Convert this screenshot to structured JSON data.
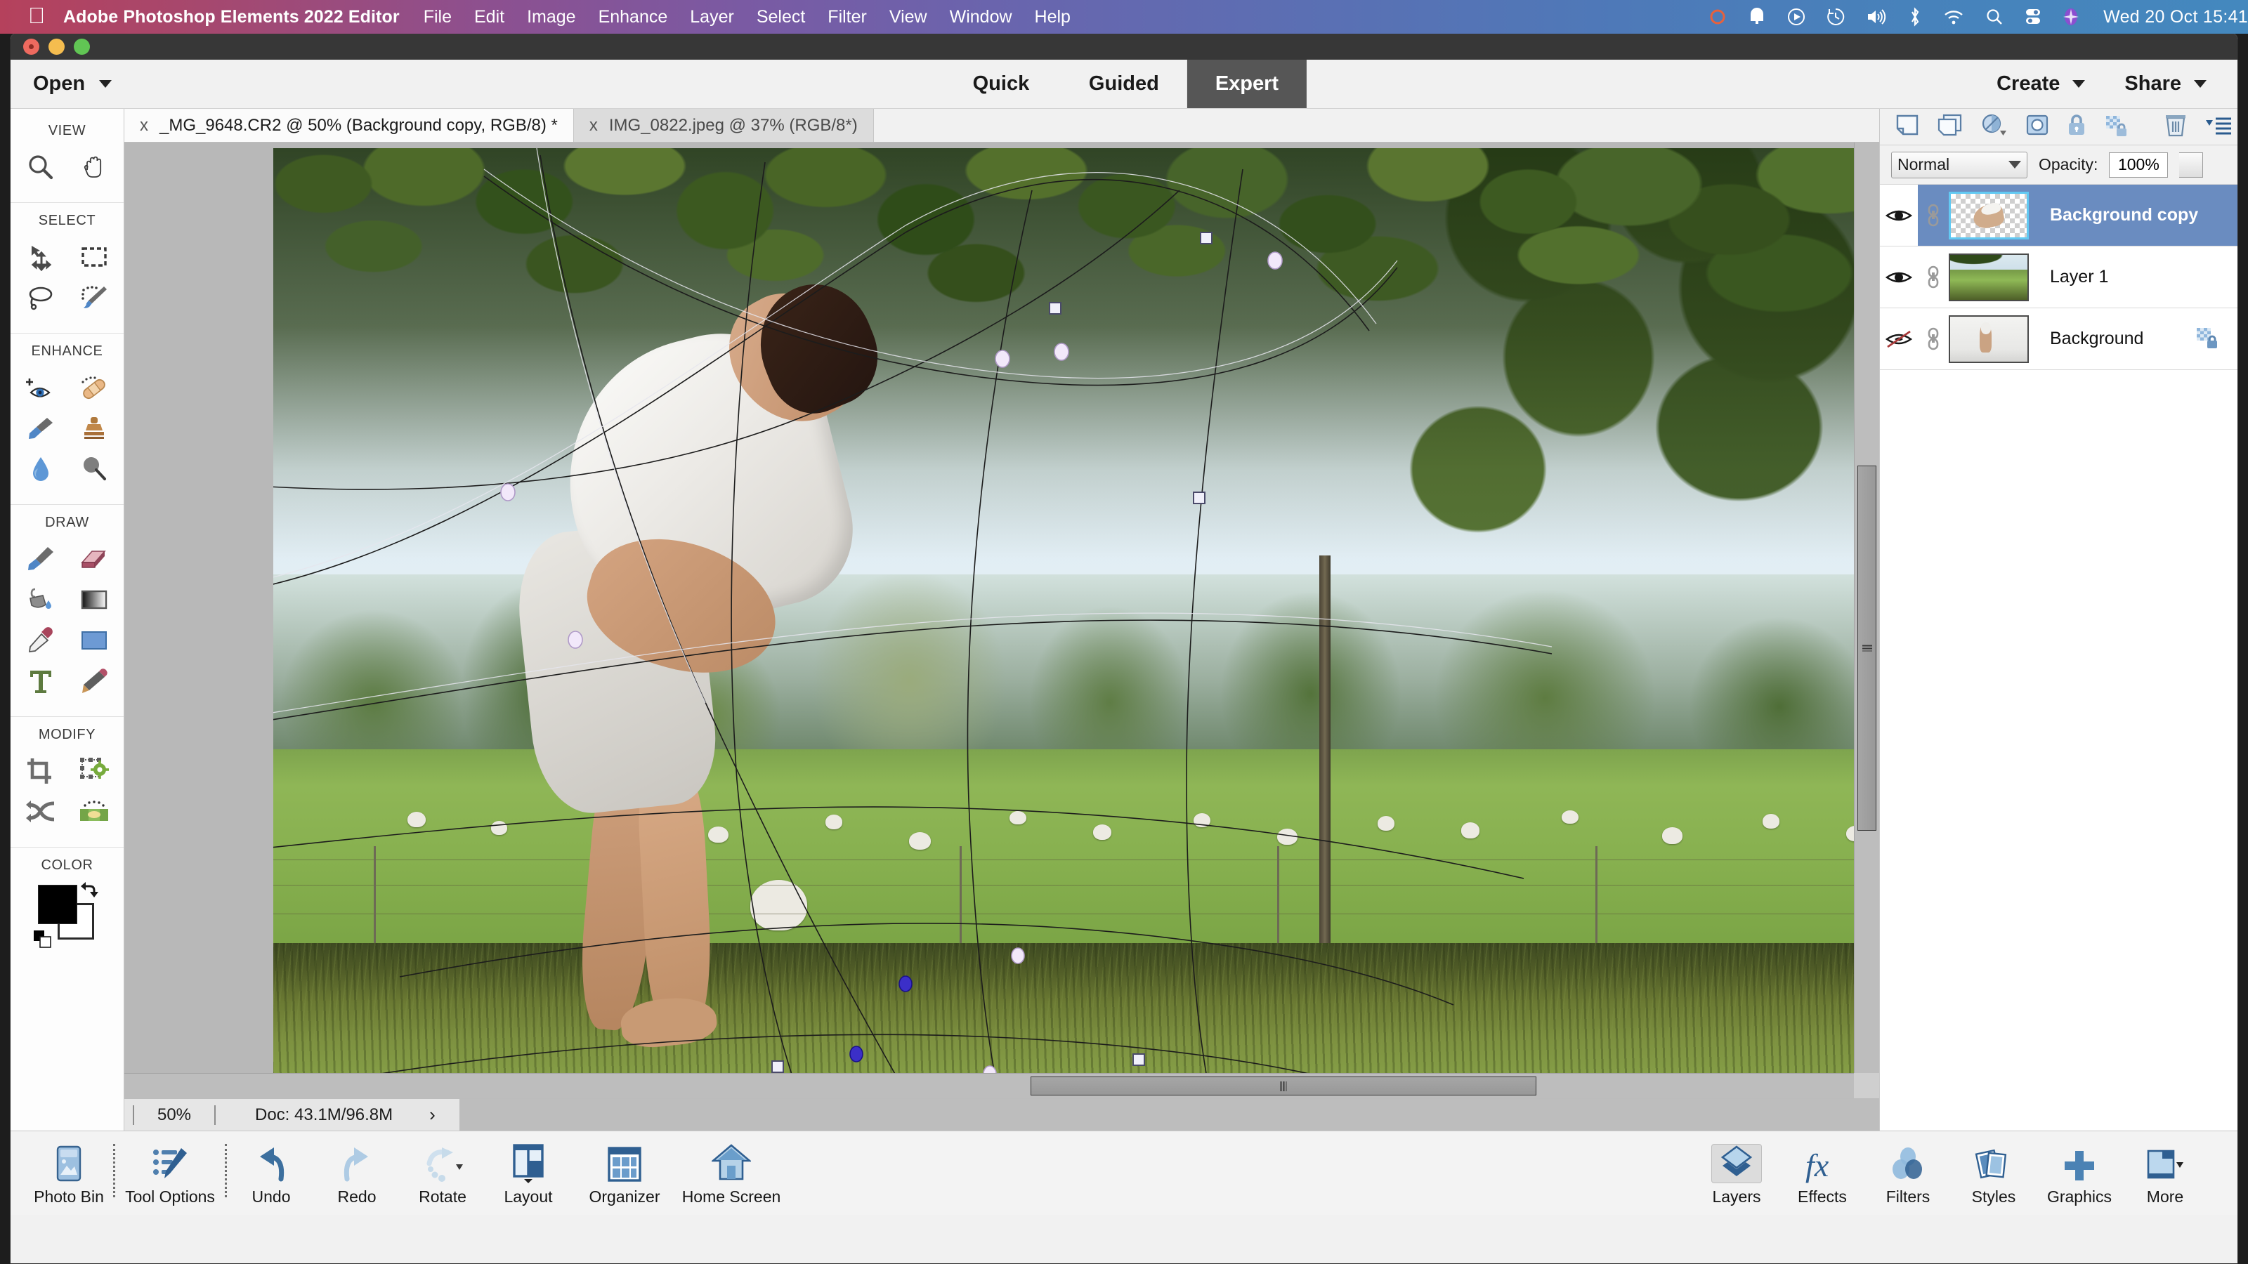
{
  "menubar": {
    "apple_icon": "apple-icon",
    "app_name": "Adobe Photoshop Elements 2022 Editor",
    "items": [
      "File",
      "Edit",
      "Image",
      "Enhance",
      "Layer",
      "Select",
      "Filter",
      "View",
      "Window",
      "Help"
    ],
    "tray_icons": [
      "control-center-record-icon",
      "notification-bell-icon",
      "play-circle-icon",
      "time-machine-icon",
      "volume-icon",
      "bluetooth-icon",
      "wifi-icon",
      "spotlight-search-icon",
      "control-center-icon",
      "siri-icon"
    ],
    "clock": "Wed 20 Oct  15:41",
    "gradient_start": "#b5415c",
    "gradient_end": "#4488be"
  },
  "window_controls": {
    "close": "close-button",
    "minimize": "minimize-button",
    "zoom": "zoom-button"
  },
  "app_toolbar": {
    "open_label": "Open",
    "modes": [
      {
        "label": "Quick",
        "active": false
      },
      {
        "label": "Guided",
        "active": false
      },
      {
        "label": "Expert",
        "active": true
      }
    ],
    "create_label": "Create",
    "share_label": "Share",
    "active_mode_bg": "#565656"
  },
  "tools": {
    "groups": [
      {
        "label": "VIEW",
        "items": [
          {
            "name": "zoom-tool",
            "icon": "magnifier-icon"
          },
          {
            "name": "hand-tool",
            "icon": "hand-icon"
          }
        ]
      },
      {
        "label": "SELECT",
        "items": [
          {
            "name": "move-tool",
            "icon": "move-arrows-icon"
          },
          {
            "name": "rectangular-marquee-tool",
            "icon": "dashed-rectangle-icon"
          },
          {
            "name": "lasso-tool",
            "icon": "lasso-icon"
          },
          {
            "name": "quick-selection-tool",
            "icon": "selection-brush-icon"
          }
        ]
      },
      {
        "label": "ENHANCE",
        "items": [
          {
            "name": "red-eye-removal-tool",
            "icon": "eye-plus-icon"
          },
          {
            "name": "spot-healing-brush-tool",
            "icon": "bandage-icon"
          },
          {
            "name": "smart-brush-tool",
            "icon": "smart-brush-icon"
          },
          {
            "name": "clone-stamp-tool",
            "icon": "stamp-icon"
          },
          {
            "name": "blur-tool",
            "icon": "water-drop-icon"
          },
          {
            "name": "sponge-tool",
            "icon": "sponge-icon"
          }
        ]
      },
      {
        "label": "DRAW",
        "items": [
          {
            "name": "brush-tool",
            "icon": "paintbrush-icon"
          },
          {
            "name": "eraser-tool",
            "icon": "eraser-icon"
          },
          {
            "name": "paint-bucket-tool",
            "icon": "paint-bucket-icon"
          },
          {
            "name": "gradient-tool",
            "icon": "gradient-icon"
          },
          {
            "name": "eyedropper-tool",
            "icon": "eyedropper-icon"
          },
          {
            "name": "shape-tool",
            "icon": "rectangle-shape-icon"
          },
          {
            "name": "type-tool",
            "icon": "type-t-icon"
          },
          {
            "name": "pencil-tool",
            "icon": "pencil-icon"
          }
        ]
      },
      {
        "label": "MODIFY",
        "items": [
          {
            "name": "crop-tool",
            "icon": "crop-icon"
          },
          {
            "name": "transform-tool",
            "icon": "transform-gear-icon"
          },
          {
            "name": "recompose-tool",
            "icon": "recompose-arrows-icon"
          },
          {
            "name": "content-aware-move-tool",
            "icon": "content-move-icon"
          }
        ]
      },
      {
        "label": "COLOR",
        "items": [
          {
            "name": "foreground-color-swatch",
            "icon": "color-swatch-icon"
          },
          {
            "name": "swap-colors",
            "icon": "swap-arrows-icon"
          },
          {
            "name": "default-colors",
            "icon": "default-colors-icon"
          }
        ]
      }
    ],
    "foreground_color": "#000000",
    "background_color": "#ffffff"
  },
  "document_tabs": [
    {
      "title": "_MG_9648.CR2 @ 50% (Background copy, RGB/8) *",
      "active": true,
      "close": "x"
    },
    {
      "title": "IMG_0822.jpeg @ 37% (RGB/8*)",
      "active": false,
      "close": "x"
    }
  ],
  "canvas": {
    "commit_label": "commit-transform",
    "cancel_label": "cancel-transform",
    "scene_description": "Tree canopy over sheep field with cut-out person composited"
  },
  "status_bar": {
    "zoom": "50%",
    "doc_info": "Doc: 43.1M/96.8M",
    "expander": "›"
  },
  "layers_panel": {
    "header_icons": [
      "new-layer-icon",
      "duplicate-layer-icon",
      "adjustment-layer-icon",
      "layer-mask-icon",
      "lock-all-icon",
      "lock-transparency-icon",
      "delete-layer-icon",
      "panel-menu-icon"
    ],
    "blend_mode": "Normal",
    "opacity_label": "Opacity:",
    "opacity_value": "100%",
    "layers": [
      {
        "name": "Background copy",
        "visible": true,
        "selected": true,
        "linked": true,
        "locked": false,
        "thumb": "transparent-cutout"
      },
      {
        "name": "Layer 1",
        "visible": true,
        "selected": false,
        "linked": true,
        "locked": false,
        "thumb": "field-scene"
      },
      {
        "name": "Background",
        "visible": false,
        "selected": false,
        "linked": true,
        "locked": true,
        "thumb": "studio-person"
      }
    ],
    "selected_row_color": "#6a8cc0"
  },
  "taskbar": {
    "left_items": [
      {
        "label": "Photo Bin",
        "icon": "photo-bin-icon",
        "active": false
      },
      {
        "label": "Tool Options",
        "icon": "tool-options-icon",
        "active": false
      },
      {
        "label": "Undo",
        "icon": "undo-arrow-icon",
        "active": false
      },
      {
        "label": "Redo",
        "icon": "redo-arrow-icon",
        "active": false
      },
      {
        "label": "Rotate",
        "icon": "rotate-icon",
        "active": false
      },
      {
        "label": "Layout",
        "icon": "layout-icon",
        "active": false
      },
      {
        "label": "Organizer",
        "icon": "organizer-grid-icon",
        "active": false
      },
      {
        "label": "Home Screen",
        "icon": "home-screen-icon",
        "active": false
      }
    ],
    "right_items": [
      {
        "label": "Layers",
        "icon": "layers-stack-icon",
        "active": true
      },
      {
        "label": "Effects",
        "icon": "fx-icon",
        "active": false
      },
      {
        "label": "Filters",
        "icon": "filters-circles-icon",
        "active": false
      },
      {
        "label": "Styles",
        "icon": "styles-cards-icon",
        "active": false
      },
      {
        "label": "Graphics",
        "icon": "plus-icon",
        "active": false
      },
      {
        "label": "More",
        "icon": "more-panel-icon",
        "active": false
      }
    ]
  }
}
